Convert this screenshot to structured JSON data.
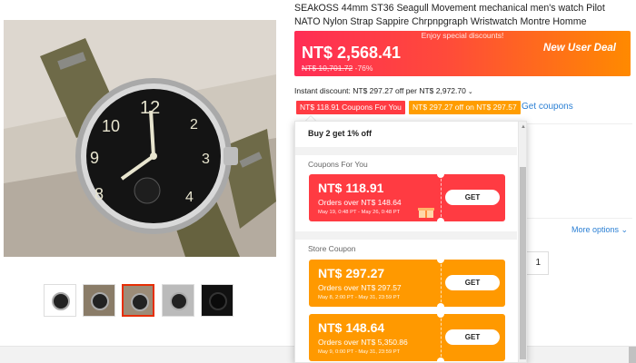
{
  "product": {
    "title": "SEAkOSS 44mm ST36 Seagull Movement mechanical men's watch Pilot NATO Nylon Strap Sappire Chrpnpgraph Wristwatch Montre Homme"
  },
  "price": {
    "promo_tip": "Enjoy special discounts!",
    "current": "NT$ 2,568.41",
    "original": "NT$ 10,701.72",
    "discount": "-76%",
    "new_user_label": "New User Deal"
  },
  "instant_discount": {
    "text": "Instant discount: NT$ 297.27 off per NT$ 2,972.70"
  },
  "coupon_tags": [
    {
      "label": "NT$ 118.91 Coupons For You"
    },
    {
      "label": "NT$ 297.27 off on NT$ 297.57"
    }
  ],
  "get_coupons_label": "Get coupons",
  "more_options_label": "More options",
  "quantity": "1",
  "dropdown": {
    "header": "Buy 2 get 1% off",
    "section_for_you": "Coupons For You",
    "section_store": "Store Coupon",
    "coupons": [
      {
        "amount": "NT$ 118.91",
        "condition": "Orders over NT$ 148.64",
        "validity": "May 19, 0:48 PT - May 26, 0:48 PT",
        "button": "GET",
        "color": "#ff3b42"
      },
      {
        "amount": "NT$ 297.27",
        "condition": "Orders over NT$ 297.57",
        "validity": "May 8, 2:00 PT - May 31, 23:59 PT",
        "button": "GET",
        "color": "#ff9900"
      },
      {
        "amount": "NT$ 148.64",
        "condition": "Orders over NT$ 5,350.86",
        "validity": "May 9, 0:00 PT - May 31, 23:59 PT",
        "button": "GET",
        "color": "#ff9900"
      }
    ]
  },
  "colors": {
    "accent_red": "#ff3b42",
    "accent_orange": "#ff9900",
    "link_blue": "#2a7fd4"
  }
}
